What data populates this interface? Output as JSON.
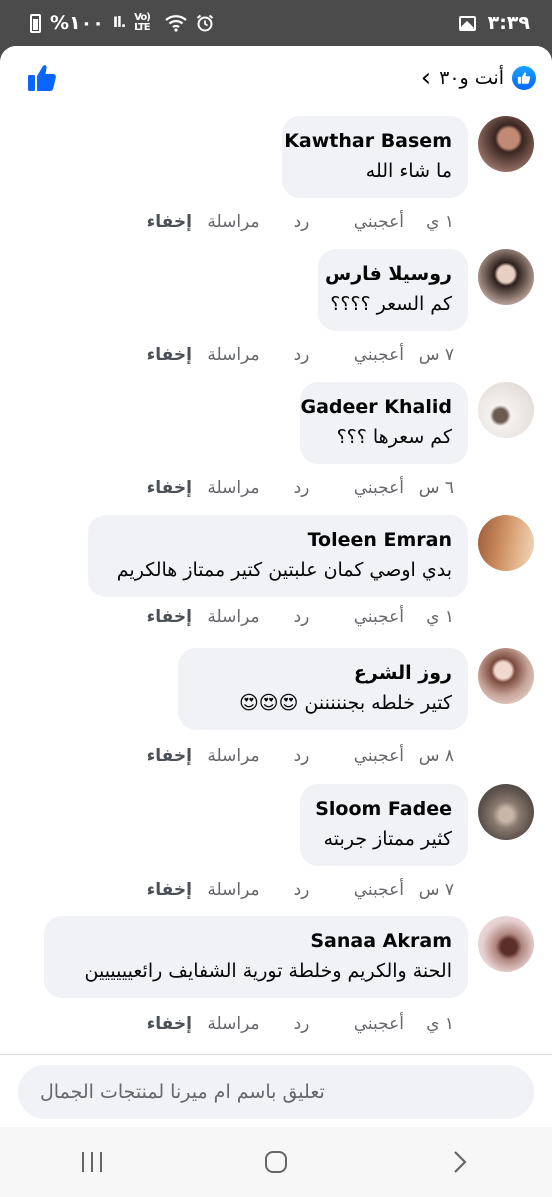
{
  "status_bar": {
    "battery_text": "%١٠٠",
    "signal_icons": "Vo) LTE",
    "time": "٣:٣٩"
  },
  "header": {
    "reactions_text": "أنت و٣٠"
  },
  "actions_labels": {
    "like": "أعجبني",
    "reply": "رد",
    "message": "مراسلة",
    "hide": "إخفاء"
  },
  "comments": [
    {
      "author": "Kawthar Basem",
      "text": "ما شاء الله",
      "time": "١ ي"
    },
    {
      "author": "روسيلا فارس",
      "text": "كم السعر ؟؟؟؟",
      "time": "٧ س"
    },
    {
      "author": "Gadeer Khalid",
      "text": "كم سعرها ؟؟؟",
      "time": "٦ س"
    },
    {
      "author": "Toleen Emran",
      "text": "بدي اوصي كمان علبتين كتير ممتاز هالكريم",
      "time": "١ ي"
    },
    {
      "author": "روز الشرع",
      "text": "كتير خلطه بجنننننن 😍😍😍",
      "time": "٨ س"
    },
    {
      "author": "Sloom Fadee",
      "text": "كثير ممتاز جربته",
      "time": "٧ س"
    },
    {
      "author": "Sanaa Akram",
      "text": "الحنة والكريم وخلطة تورية الشفايف رائعيييييين",
      "time": "١ ي"
    }
  ],
  "composer": {
    "placeholder": "تعليق باسم ام ميرنا لمنتجات الجمال"
  },
  "colors": {
    "accent": "#0866ff",
    "bubble": "#f0f2f5",
    "secondary_text": "#65676b"
  }
}
